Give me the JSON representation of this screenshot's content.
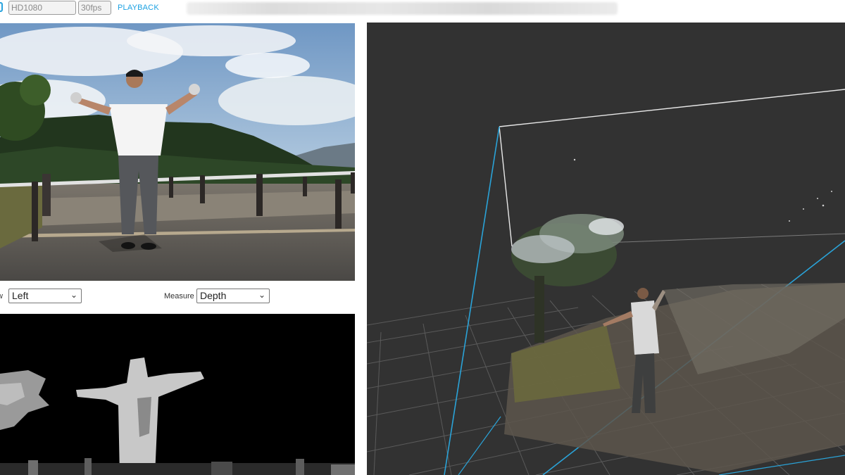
{
  "toolbar": {
    "resolution": "HD1080",
    "fps": "30fps",
    "playback_label": "PLAYBACK"
  },
  "controls": {
    "view_label": "w",
    "view_value": "Left",
    "measure_label": "Measure",
    "measure_value": "Depth"
  },
  "colors": {
    "accent": "#1ba1e2",
    "viewer_background": "#323232",
    "grid": "#5a5a5a",
    "frustum_blue": "#2aa3d8",
    "frustum_white": "#e8e8e8"
  },
  "icons": {
    "dropdown": "chevron-down-icon"
  }
}
